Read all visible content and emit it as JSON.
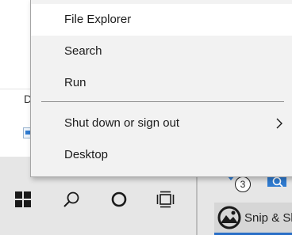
{
  "background": {
    "column_header_letter": "D"
  },
  "context_menu": {
    "items": [
      {
        "label": "File Explorer",
        "highlighted": true
      },
      {
        "label": "Search"
      },
      {
        "label": "Run"
      },
      {
        "label": "Shut down or sign out",
        "has_submenu": true
      },
      {
        "label": "Desktop"
      }
    ]
  },
  "taskbar": {
    "buttons": [
      {
        "icon": "windows-start-icon"
      },
      {
        "icon": "search-icon"
      },
      {
        "icon": "cortana-circle-icon"
      },
      {
        "icon": "task-view-icon"
      }
    ],
    "tray_badge_count": "3",
    "running_app": {
      "label": "Snip & Sk",
      "icon": "snip-and-sketch-icon"
    }
  },
  "colors": {
    "menu_bg": "#f2f2f2",
    "menu_highlight": "#ffffff",
    "taskbar_bg": "#e6e6e6",
    "accent": "#2a6fc7"
  }
}
